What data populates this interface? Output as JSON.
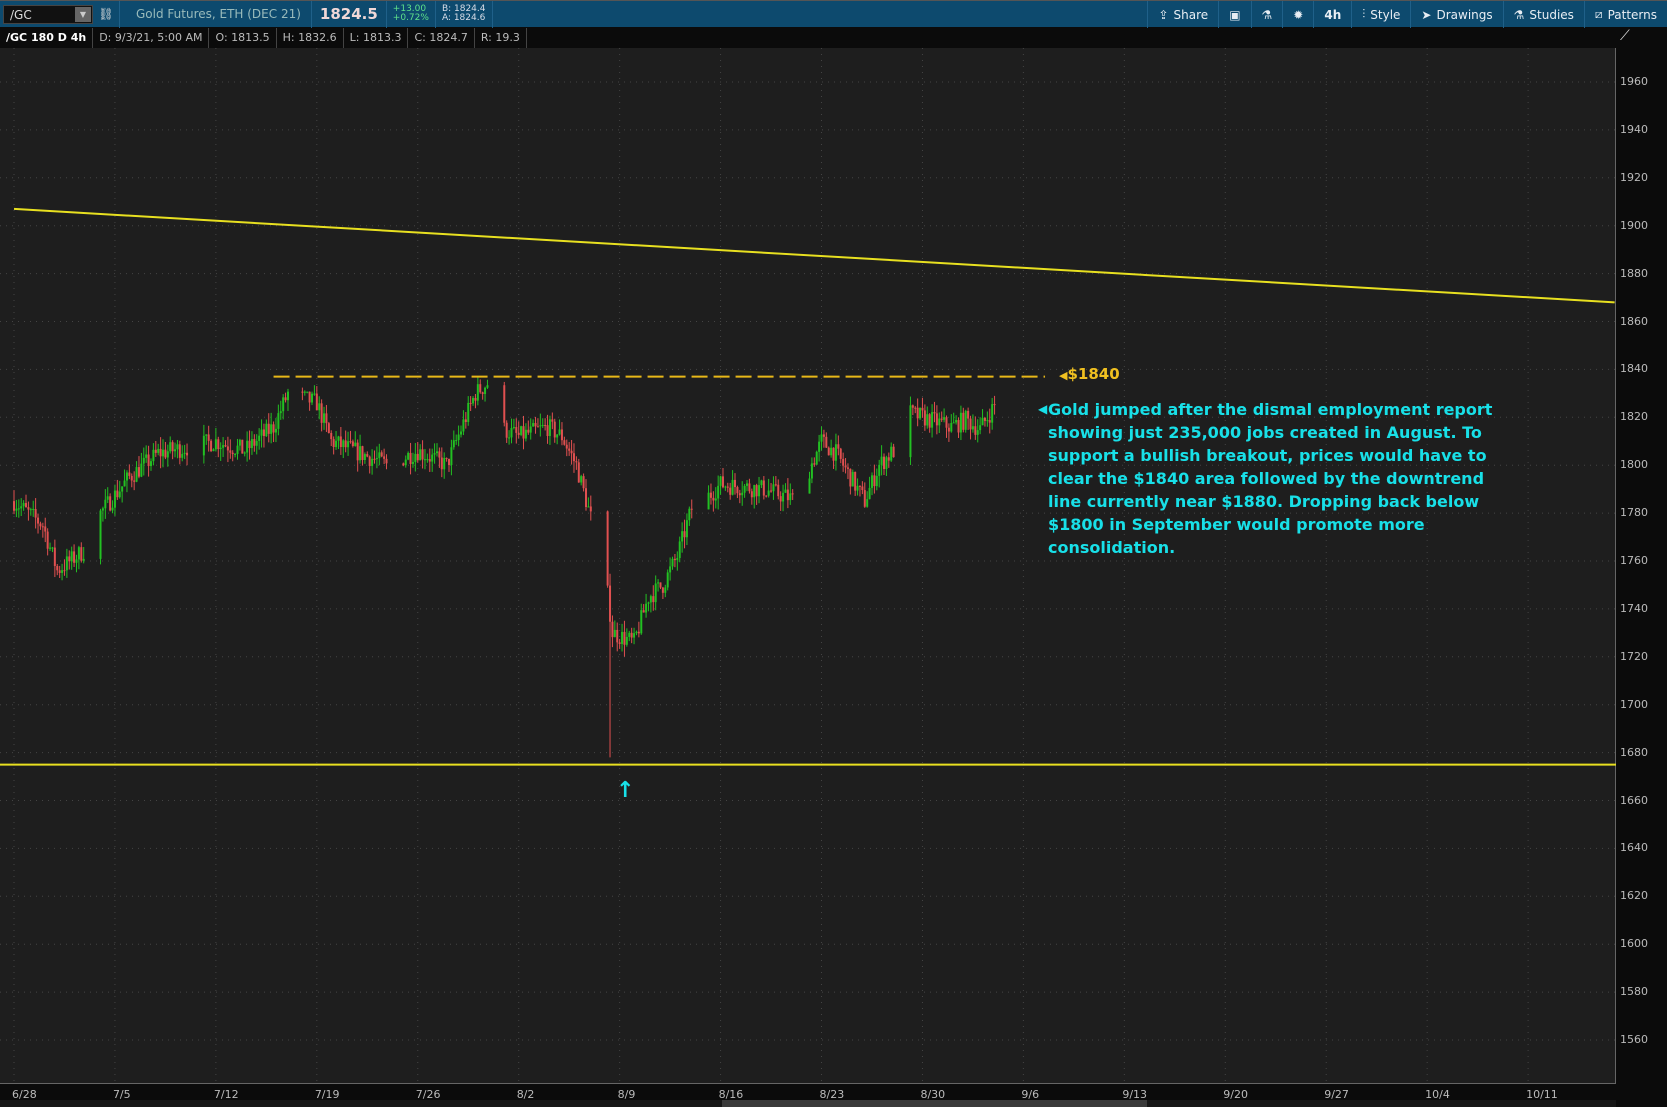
{
  "header": {
    "symbol": "/GC",
    "description": "Gold Futures, ETH (DEC 21)",
    "last": "1824.5",
    "change": "+13.00",
    "change_pct": "+0.72%",
    "bid": "B: 1824.4",
    "ask": "A: 1824.6",
    "tools": {
      "share": "Share",
      "timeframe": "4h",
      "style": "Style",
      "drawings": "Drawings",
      "studies": "Studies",
      "patterns": "Patterns"
    }
  },
  "info": {
    "label": "/GC 180 D 4h",
    "date": "D: 9/3/21, 5:00 AM",
    "open": "O: 1813.5",
    "high": "H: 1832.6",
    "low": "L: 1813.3",
    "close": "C: 1824.7",
    "range": "R: 19.3"
  },
  "annotations": {
    "level_label": "$1840",
    "note": "Gold jumped after the dismal employment report showing just 235,000 jobs created in August. To support a bullish breakout, prices would have to clear the $1840 area followed by the downtrend line currently near $1880. Dropping back below $1800 in September would promote more consolidation.",
    "arrow": "↑"
  },
  "colors": {
    "up": "#22c022",
    "down": "#e05050",
    "trend": "#e8e020",
    "level": "#e8b818",
    "note": "#18e0e8"
  },
  "chart_data": {
    "type": "candlestick",
    "title": "/GC 180 D 4h",
    "ylim": [
      1545,
      1975
    ],
    "yticks": [
      1960,
      1940,
      1920,
      1900,
      1880,
      1860,
      1840,
      1820,
      1800,
      1780,
      1760,
      1740,
      1720,
      1700,
      1680,
      1660,
      1640,
      1620,
      1600,
      1580,
      1560
    ],
    "xticks": [
      "6/28",
      "7/5",
      "7/12",
      "7/19",
      "7/26",
      "8/2",
      "8/9",
      "8/16",
      "8/23",
      "8/30",
      "9/6",
      "9/13",
      "9/20",
      "9/27",
      "10/4",
      "10/11"
    ],
    "price_path_day_close": [
      [
        0,
        1785
      ],
      [
        2,
        1775
      ],
      [
        3,
        1756
      ],
      [
        5,
        1765
      ],
      [
        6,
        1780
      ],
      [
        8,
        1795
      ],
      [
        10,
        1805
      ],
      [
        14,
        1810
      ],
      [
        16,
        1806
      ],
      [
        18,
        1816
      ],
      [
        19,
        1830
      ],
      [
        21,
        1826
      ],
      [
        22,
        1810
      ],
      [
        24,
        1805
      ],
      [
        26,
        1800
      ],
      [
        28,
        1806
      ],
      [
        30,
        1800
      ],
      [
        31,
        1815
      ],
      [
        32,
        1830
      ],
      [
        33,
        1835
      ],
      [
        34,
        1815
      ],
      [
        35,
        1812
      ],
      [
        37,
        1816
      ],
      [
        38,
        1812
      ],
      [
        39,
        1800
      ],
      [
        40.6,
        1765
      ],
      [
        41.2,
        1745
      ],
      [
        41.5,
        1730
      ],
      [
        43,
        1726
      ],
      [
        44,
        1745
      ],
      [
        45,
        1750
      ],
      [
        46,
        1762
      ],
      [
        47,
        1782
      ],
      [
        48,
        1786
      ],
      [
        49,
        1792
      ],
      [
        52,
        1790
      ],
      [
        54,
        1786
      ],
      [
        55,
        1796
      ],
      [
        56,
        1810
      ],
      [
        57,
        1805
      ],
      [
        58,
        1795
      ],
      [
        59,
        1785
      ],
      [
        60,
        1800
      ],
      [
        61,
        1806
      ],
      [
        62,
        1822
      ],
      [
        63,
        1820
      ],
      [
        65,
        1816
      ],
      [
        66,
        1819
      ],
      [
        67,
        1815
      ],
      [
        68,
        1825
      ]
    ],
    "flash_crash_low": 1678,
    "downtrend_line": {
      "start": [
        0,
        1907
      ],
      "end": [
        111,
        1868
      ]
    },
    "support_line": 1675,
    "resistance_line": {
      "price": 1837,
      "from_day": 18,
      "to_day": 71.5
    }
  }
}
